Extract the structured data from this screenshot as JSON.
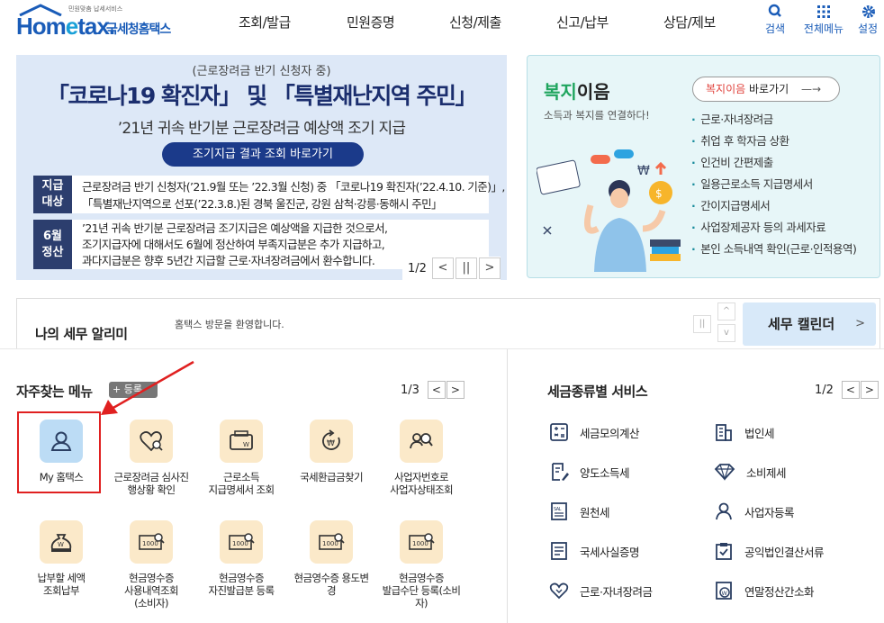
{
  "header": {
    "logo_tagline": "민원맞춤 납세서비스",
    "logo_home": "Hom",
    "logo_e": "e",
    "logo_tax": "tax.",
    "logo_kr": "국세청홈택스",
    "nav": [
      "조회/발급",
      "민원증명",
      "신청/제출",
      "신고/납부",
      "상담/제보"
    ],
    "tools": [
      {
        "label": "검색",
        "icon": "search-icon"
      },
      {
        "label": "전체메뉴",
        "icon": "grid-icon"
      },
      {
        "label": "설정",
        "icon": "gear-icon"
      }
    ]
  },
  "banner": {
    "sub": "(근로장려금 반기 신청자 중)",
    "main": "「코로나19 확진자」 및 「특별재난지역 주민」",
    "line3": "’21년 귀속 반기분 근로장려금 예상액 조기 지급",
    "button": "조기지급 결과 조회 바로가기",
    "info1_key": "지급\n대상",
    "info1_l1": "근로장려금 반기 신청자(’21.9월 또는 ’22.3월 신청) 중 「코로나19 확진자(’22.4.10. 기준)」,",
    "info1_l2": "「특별재난지역으로 선포(’22.3.8.)된 경북 울진군, 강원 삼척·강릉·동해시 주민」",
    "info2_key": "6월\n정산",
    "info2_l1": "’21년 귀속 반기분 근로장려금 조기지급은 예상액을 지급한 것으로서,",
    "info2_l2": "조기지급자에 대해서도 6월에 정산하여 부족지급분은 추가 지급하고,",
    "info2_l3": "과다지급분은 향후 5년간 지급할 근로·자녀장려금에서 환수합니다.",
    "page": "1/2",
    "prev": "<",
    "pause": "||",
    "next": ">"
  },
  "welfare": {
    "title_a": "복지",
    "title_b": "이음",
    "subtitle": "소득과 복지를 연결하다!",
    "go_a": "복지이음",
    "go_b": " 바로가기",
    "go_arrow": "—→",
    "items": [
      "근로·자녀장려금",
      "취업 후 학자금 상환",
      "인건비 간편제출",
      "일용근로소득 지급명세서",
      "간이지급명세서",
      "사업장제공자 등의 과세자료",
      "본인 소득내역 확인(근로·인적용역)"
    ]
  },
  "alarm": {
    "title": "나의 세무 알리미",
    "message": "홈택스 방문을 환영합니다.",
    "pause": "||",
    "up": "^",
    "down": "v",
    "calendar": "세무 캘린더",
    "calendar_arrow": ">"
  },
  "frequent": {
    "title": "자주찾는 메뉴",
    "add": "+ 등록",
    "page": "1/3",
    "prev": "<",
    "next": ">",
    "items": [
      {
        "label": "My 홈택스",
        "icon": "person-icon"
      },
      {
        "label": "근로장려금 심사진\n행상황 확인",
        "icon": "heart-search-icon"
      },
      {
        "label": "근로소득\n지급명세서 조회",
        "icon": "wallet-icon"
      },
      {
        "label": "국세환급금찾기",
        "icon": "refund-icon"
      },
      {
        "label": "사업자번호로\n사업자상태조회",
        "icon": "people-search-icon"
      },
      {
        "label": "납부할 세액\n조회납부",
        "icon": "money-bag-icon"
      },
      {
        "label": "현금영수증\n사용내역조회\n(소비자)",
        "icon": "receipt-search-icon"
      },
      {
        "label": "현금영수증\n자진발급분 등록",
        "icon": "receipt-search-icon"
      },
      {
        "label": "현금영수증 용도변\n경",
        "icon": "receipt-search-icon"
      },
      {
        "label": "현금영수증\n발급수단 등록(소비\n자)",
        "icon": "receipt-search-icon"
      }
    ]
  },
  "taxservice": {
    "title": "세금종류별 서비스",
    "page": "1/2",
    "prev": "<",
    "next": ">",
    "left": [
      {
        "label": "세금모의계산",
        "icon": "calculator-icon"
      },
      {
        "label": "양도소득세",
        "icon": "document-pen-icon"
      },
      {
        "label": "원천세",
        "icon": "receipt-icon"
      },
      {
        "label": "국세사실증명",
        "icon": "certificate-icon"
      },
      {
        "label": "근로·자녀장려금",
        "icon": "heart-icon"
      }
    ],
    "right": [
      {
        "label": "법인세",
        "icon": "building-icon"
      },
      {
        "label": "소비제세",
        "icon": "diamond-icon"
      },
      {
        "label": "사업자등록",
        "icon": "person-icon"
      },
      {
        "label": "공익법인결산서류",
        "icon": "clipboard-check-icon"
      },
      {
        "label": "연말정산간소화",
        "icon": "won-document-icon"
      }
    ]
  }
}
